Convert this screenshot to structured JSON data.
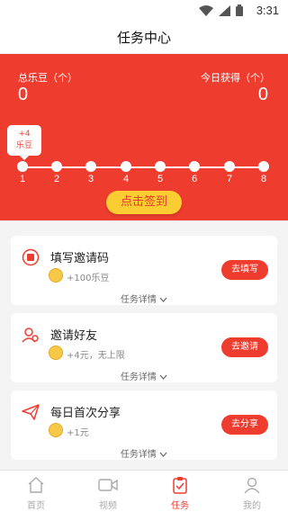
{
  "status_bar": {
    "time": "3:31"
  },
  "header": {
    "title": "任务中心"
  },
  "summary": {
    "total_label": "总乐豆（个）",
    "total_value": "0",
    "today_label": "今日获得（个）",
    "today_value": "0"
  },
  "streak": {
    "bubble_plus": "+4",
    "bubble_unit": "乐豆",
    "days": [
      "1",
      "2",
      "3",
      "4",
      "5",
      "6",
      "7",
      "8"
    ]
  },
  "checkin_button": "点击签到",
  "tasks": [
    {
      "title": "填写邀请码",
      "reward": "+100乐豆",
      "detail": "任务详情",
      "button": "去填写"
    },
    {
      "title": "邀请好友",
      "reward": "+4元，无上限",
      "detail": "任务详情",
      "button": "去邀请"
    },
    {
      "title": "每日首次分享",
      "reward": "+1元",
      "detail": "任务详情",
      "button": "去分享"
    }
  ],
  "tabbar": [
    {
      "label": "首页",
      "icon": "home-icon"
    },
    {
      "label": "视频",
      "icon": "video-icon"
    },
    {
      "label": "任务",
      "icon": "task-icon",
      "active": true
    },
    {
      "label": "我的",
      "icon": "profile-icon"
    }
  ],
  "colors": {
    "accent": "#ee3d2f",
    "checkin": "#fccd33"
  }
}
